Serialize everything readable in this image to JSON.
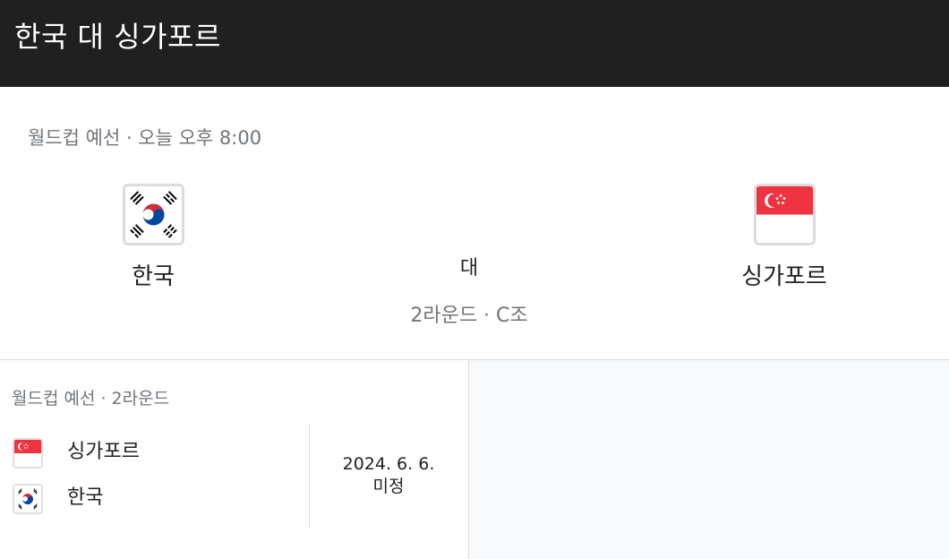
{
  "header": {
    "title": "한국 대 싱가포르"
  },
  "match": {
    "meta": "월드컵 예선 · 오늘 오후 8:00",
    "home_team": {
      "name": "한국",
      "flag_icon": "south-korea-flag-icon"
    },
    "away_team": {
      "name": "싱가포르",
      "flag_icon": "singapore-flag-icon"
    },
    "versus": "대",
    "round": "2라운드 · C조"
  },
  "schedule": {
    "title": "월드컵 예선 · 2라운드",
    "teams": [
      {
        "name": "싱가포르",
        "flag_icon": "singapore-flag-icon"
      },
      {
        "name": "한국",
        "flag_icon": "south-korea-flag-icon"
      }
    ],
    "date": "2024. 6. 6.",
    "status": "미정"
  },
  "colors": {
    "header_bg": "#202020",
    "muted_text": "#70757a",
    "singapore_red": "#ef3340",
    "korea_red": "#cd2e3a",
    "korea_blue": "#0047a0"
  }
}
